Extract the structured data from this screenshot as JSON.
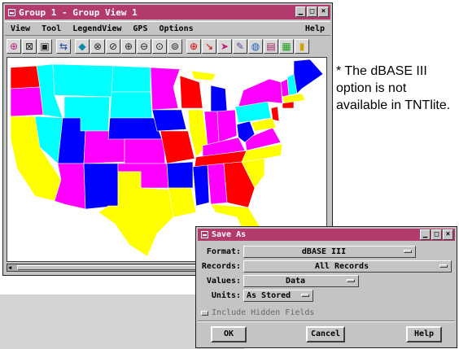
{
  "main_window": {
    "title": "Group 1 - Group View 1",
    "menu": [
      "View",
      "Tool",
      "LegendView",
      "GPS",
      "Options"
    ],
    "help_label": "Help",
    "title_buttons": [
      "▁",
      "□",
      "×"
    ],
    "toolbar_icons": [
      "zoom-full-icon",
      "zoom-box-icon",
      "fit-window-icon",
      "redraw-icon",
      "pan-icon",
      "zoom-in-step-icon",
      "zoom-out-step-icon",
      "zoom-in-icon",
      "zoom-out-icon",
      "zoom-prev-icon",
      "zoom-next-icon",
      "select-icon",
      "arrow-select-icon",
      "pointer-icon",
      "edit-icon",
      "measure-icon",
      "layer-controls-icon",
      "color-icon",
      "legend-icon"
    ]
  },
  "note": {
    "text": "* The dBASE III option is not available in TNTlite."
  },
  "dialog": {
    "title": "Save As",
    "title_buttons": [
      "▁",
      "□",
      "×"
    ],
    "format_label": "Format:",
    "format_value": "dBASE III",
    "records_label": "Records:",
    "records_value": "All Records",
    "values_label": "Values:",
    "values_value": "Data",
    "units_label": "Units:",
    "units_value": "As Stored",
    "include_hidden_label": "Include Hidden Fields",
    "ok_label": "OK",
    "cancel_label": "Cancel",
    "help_label": "Help"
  },
  "colors": {
    "titlebar": "#b23a6d",
    "window_bg": "#c4c4c4",
    "map_magenta": "#ff00ff",
    "map_yellow": "#ffff00",
    "map_cyan": "#00ffff",
    "map_blue": "#0000ff",
    "map_red": "#ff0000"
  }
}
